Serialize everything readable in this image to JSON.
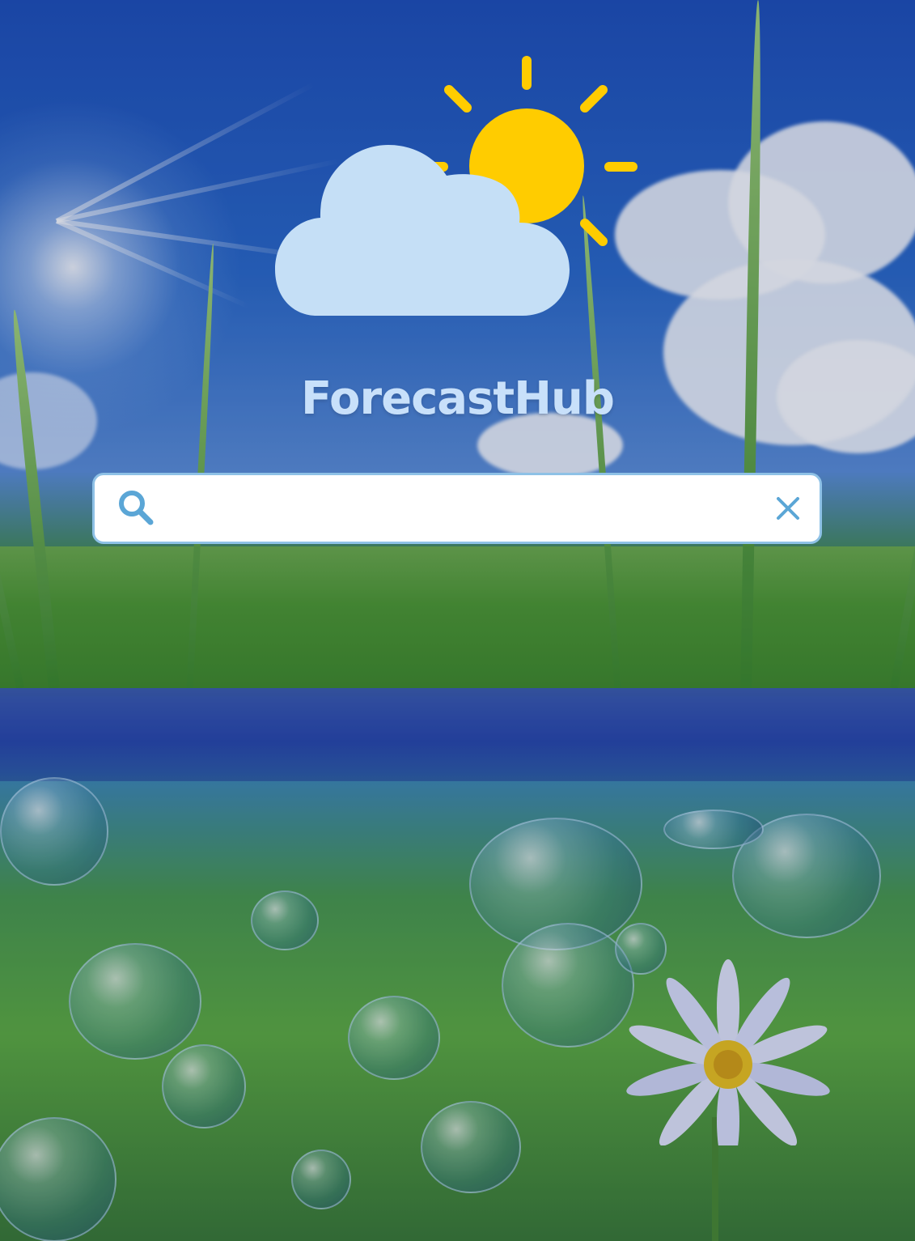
{
  "app": {
    "title": "ForecastHub"
  },
  "logo": {
    "icon": "partly-sunny-weather-icon",
    "sun_color": "#FFCC00",
    "cloud_color": "#C5DFF6"
  },
  "search": {
    "value": "",
    "placeholder": "",
    "search_icon": "search-icon",
    "clear_icon": "close-icon",
    "accent_color": "#5BA6D6"
  },
  "background": {
    "description_icon": "nature-grass-water-background"
  }
}
